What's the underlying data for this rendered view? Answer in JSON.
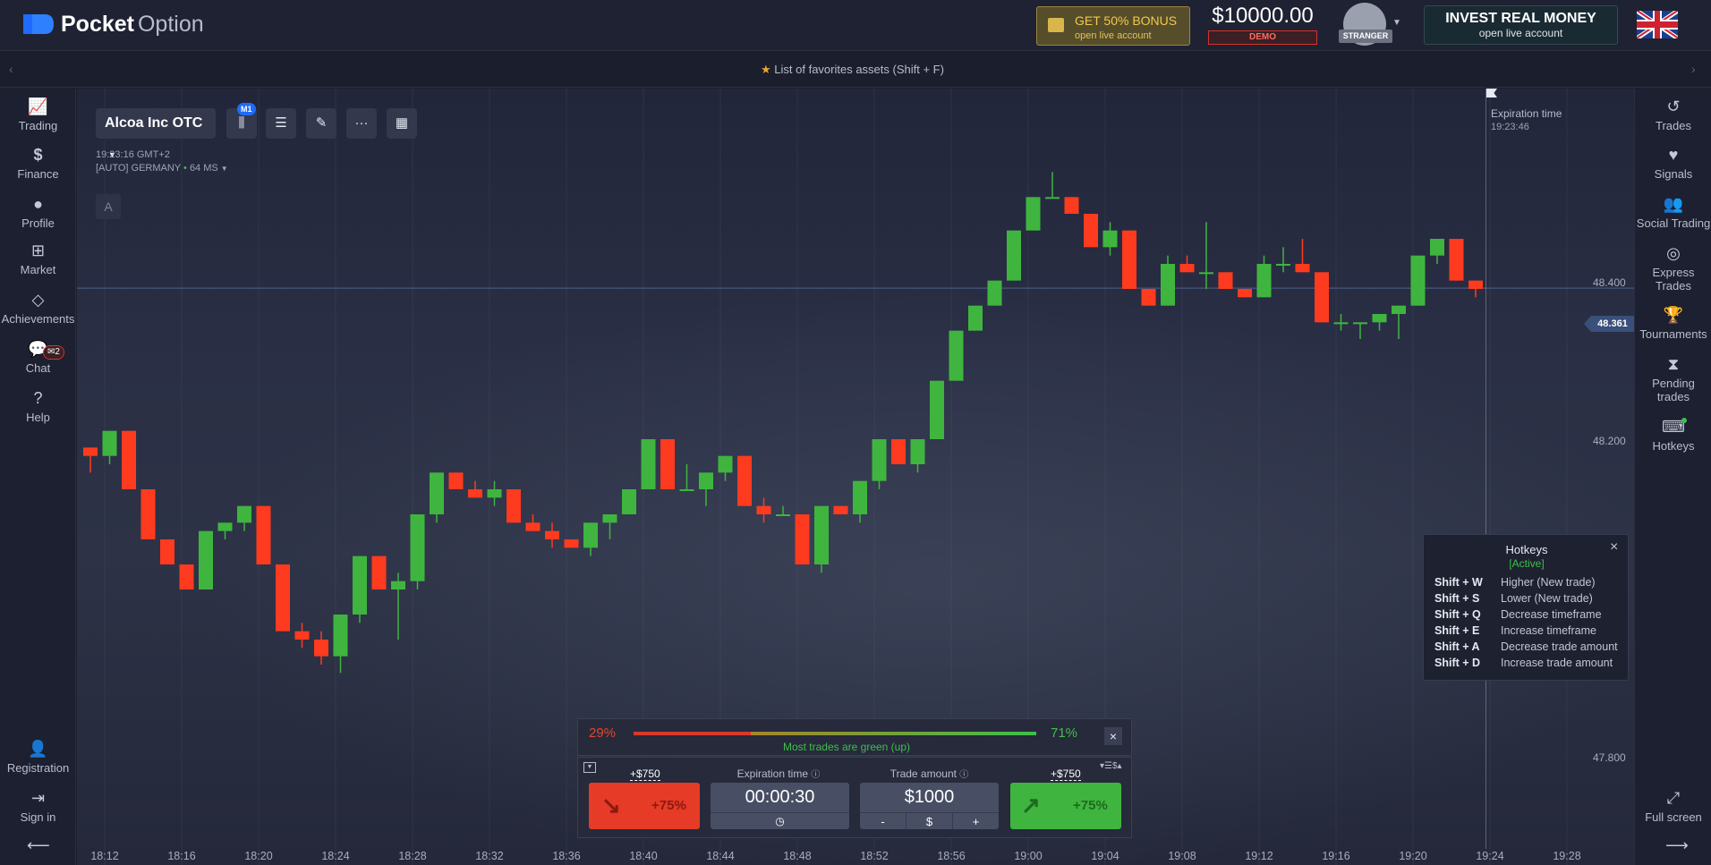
{
  "brand": {
    "name_bold": "Pocket",
    "name_light": "Option"
  },
  "header": {
    "bonus_title": "GET 50% BONUS",
    "bonus_sub": "open live account",
    "balance": "$10000.00",
    "account_type": "DEMO",
    "user_status": "STRANGER",
    "invest_title": "INVEST REAL MONEY",
    "invest_sub": "open live account",
    "language_flag": "uk-flag-icon"
  },
  "favorites": {
    "text": "List of favorites assets (Shift + F)"
  },
  "left_nav": [
    {
      "label": "Trading",
      "icon": "chart-line-icon"
    },
    {
      "label": "Finance",
      "icon": "dollar-icon"
    },
    {
      "label": "Profile",
      "icon": "user-icon"
    },
    {
      "label": "Market",
      "icon": "cart-icon"
    },
    {
      "label": "Achievements",
      "icon": "diamond-icon"
    },
    {
      "label": "Chat",
      "icon": "chat-icon",
      "badge": "2"
    },
    {
      "label": "Help",
      "icon": "help-icon"
    }
  ],
  "left_nav_bottom": [
    {
      "label": "Registration",
      "icon": "user-plus-icon"
    },
    {
      "label": "Sign in",
      "icon": "sign-in-icon"
    }
  ],
  "right_nav": [
    {
      "label": "Trades",
      "icon": "history-icon"
    },
    {
      "label": "Signals",
      "icon": "heartbeat-icon"
    },
    {
      "label": "Social Trading",
      "icon": "users-icon"
    },
    {
      "label": "Express Trades",
      "icon": "target-icon"
    },
    {
      "label": "Tournaments",
      "icon": "trophy-icon"
    },
    {
      "label": "Pending trades",
      "icon": "hourglass-icon"
    },
    {
      "label": "Hotkeys",
      "icon": "keyboard-icon"
    }
  ],
  "right_nav_bottom": {
    "label": "Full screen",
    "icon": "expand-icon"
  },
  "chart_toolbar": {
    "asset": "Alcoa Inc OTC",
    "timeframe_badge": "M1",
    "time": "19:23:16 GMT+2",
    "server": "[AUTO] GERMANY",
    "ping": "64 MS",
    "indicator_letter": "A"
  },
  "expiration": {
    "label": "Expiration time",
    "time": "19:23:46"
  },
  "hotkeys": {
    "title": "Hotkeys",
    "status": "[Active]",
    "items": [
      {
        "key": "Shift + W",
        "desc": "Higher (New trade)"
      },
      {
        "key": "Shift + S",
        "desc": "Lower (New trade)"
      },
      {
        "key": "Shift + Q",
        "desc": "Decrease timeframe"
      },
      {
        "key": "Shift + E",
        "desc": "Increase timeframe"
      },
      {
        "key": "Shift + A",
        "desc": "Decrease trade amount"
      },
      {
        "key": "Shift + D",
        "desc": "Increase trade amount"
      }
    ]
  },
  "sentiment": {
    "down_pct": "29%",
    "up_pct": "71%",
    "up_fraction": 0.71,
    "text": "Most trades are green (up)"
  },
  "trade_panel": {
    "payout_down": "+$750",
    "payout_up": "+$750",
    "down_percent": "+75%",
    "up_percent": "+75%",
    "expiration_label": "Expiration time",
    "expiration_value": "00:00:30",
    "amount_label": "Trade amount",
    "amount_value": "$1000",
    "minus": "-",
    "currency": "$",
    "plus": "+"
  },
  "current_price": "48.361",
  "chart_data": {
    "type": "candlestick",
    "x_ticks": [
      "18:12",
      "18:16",
      "18:20",
      "18:24",
      "18:28",
      "18:32",
      "18:36",
      "18:40",
      "18:44",
      "18:48",
      "18:52",
      "18:56",
      "19:00",
      "19:04",
      "19:08",
      "19:12",
      "19:16",
      "19:20",
      "19:24",
      "19:28"
    ],
    "y_ticks": [
      "48.400",
      "48.200",
      "47.800"
    ],
    "ylim": [
      47.67,
      48.6
    ],
    "candles": [
      [
        48.17,
        48.17,
        48.14,
        48.16
      ],
      [
        48.16,
        48.19,
        48.15,
        48.19
      ],
      [
        48.19,
        48.19,
        48.12,
        48.12
      ],
      [
        48.12,
        48.12,
        48.06,
        48.06
      ],
      [
        48.06,
        48.06,
        48.03,
        48.03
      ],
      [
        48.03,
        48.03,
        48.0,
        48.0
      ],
      [
        48.0,
        48.07,
        48.0,
        48.07
      ],
      [
        48.07,
        48.08,
        48.06,
        48.08
      ],
      [
        48.08,
        48.1,
        48.07,
        48.1
      ],
      [
        48.1,
        48.1,
        48.03,
        48.03
      ],
      [
        48.03,
        48.03,
        47.95,
        47.95
      ],
      [
        47.95,
        47.96,
        47.93,
        47.94
      ],
      [
        47.94,
        47.95,
        47.91,
        47.92
      ],
      [
        47.92,
        47.97,
        47.9,
        47.97
      ],
      [
        47.97,
        48.04,
        47.96,
        48.04
      ],
      [
        48.04,
        48.04,
        48.0,
        48.0
      ],
      [
        48.0,
        48.02,
        47.94,
        48.01
      ],
      [
        48.01,
        48.09,
        48.0,
        48.09
      ],
      [
        48.09,
        48.14,
        48.08,
        48.14
      ],
      [
        48.14,
        48.14,
        48.12,
        48.12
      ],
      [
        48.12,
        48.13,
        48.11,
        48.11
      ],
      [
        48.11,
        48.13,
        48.1,
        48.12
      ],
      [
        48.12,
        48.12,
        48.08,
        48.08
      ],
      [
        48.08,
        48.09,
        48.07,
        48.07
      ],
      [
        48.07,
        48.08,
        48.05,
        48.06
      ],
      [
        48.06,
        48.06,
        48.05,
        48.05
      ],
      [
        48.05,
        48.08,
        48.04,
        48.08
      ],
      [
        48.08,
        48.09,
        48.06,
        48.09
      ],
      [
        48.09,
        48.12,
        48.09,
        48.12
      ],
      [
        48.12,
        48.18,
        48.12,
        48.18
      ],
      [
        48.18,
        48.18,
        48.12,
        48.12
      ],
      [
        48.12,
        48.15,
        48.12,
        48.12
      ],
      [
        48.12,
        48.14,
        48.1,
        48.14
      ],
      [
        48.14,
        48.16,
        48.13,
        48.16
      ],
      [
        48.16,
        48.16,
        48.1,
        48.1
      ],
      [
        48.1,
        48.11,
        48.08,
        48.09
      ],
      [
        48.09,
        48.1,
        48.09,
        48.09
      ],
      [
        48.09,
        48.09,
        48.03,
        48.03
      ],
      [
        48.03,
        48.1,
        48.02,
        48.1
      ],
      [
        48.1,
        48.1,
        48.09,
        48.09
      ],
      [
        48.09,
        48.13,
        48.08,
        48.13
      ],
      [
        48.13,
        48.18,
        48.12,
        48.18
      ],
      [
        48.18,
        48.18,
        48.15,
        48.15
      ],
      [
        48.15,
        48.18,
        48.14,
        48.18
      ],
      [
        48.18,
        48.25,
        48.18,
        48.25
      ],
      [
        48.25,
        48.31,
        48.25,
        48.31
      ],
      [
        48.31,
        48.34,
        48.31,
        48.34
      ],
      [
        48.34,
        48.37,
        48.34,
        48.37
      ],
      [
        48.37,
        48.43,
        48.37,
        48.43
      ],
      [
        48.43,
        48.47,
        48.43,
        48.47
      ],
      [
        48.47,
        48.5,
        48.47,
        48.47
      ],
      [
        48.47,
        48.47,
        48.45,
        48.45
      ],
      [
        48.45,
        48.45,
        48.41,
        48.41
      ],
      [
        48.41,
        48.44,
        48.4,
        48.43
      ],
      [
        48.43,
        48.43,
        48.36,
        48.36
      ],
      [
        48.36,
        48.36,
        48.34,
        48.34
      ],
      [
        48.34,
        48.4,
        48.34,
        48.39
      ],
      [
        48.39,
        48.4,
        48.38,
        48.38
      ],
      [
        48.38,
        48.44,
        48.36,
        48.38
      ],
      [
        48.38,
        48.38,
        48.36,
        48.36
      ],
      [
        48.36,
        48.36,
        48.35,
        48.35
      ],
      [
        48.35,
        48.4,
        48.35,
        48.39
      ],
      [
        48.39,
        48.41,
        48.38,
        48.39
      ],
      [
        48.39,
        48.42,
        48.38,
        48.38
      ],
      [
        48.38,
        48.38,
        48.32,
        48.32
      ],
      [
        48.32,
        48.33,
        48.31,
        48.32
      ],
      [
        48.32,
        48.32,
        48.3,
        48.32
      ],
      [
        48.32,
        48.33,
        48.31,
        48.33
      ],
      [
        48.33,
        48.34,
        48.3,
        48.34
      ],
      [
        48.34,
        48.4,
        48.34,
        48.4
      ],
      [
        48.4,
        48.42,
        48.39,
        48.42
      ],
      [
        48.42,
        48.42,
        48.37,
        48.37
      ],
      [
        48.37,
        48.37,
        48.35,
        48.36
      ]
    ]
  }
}
